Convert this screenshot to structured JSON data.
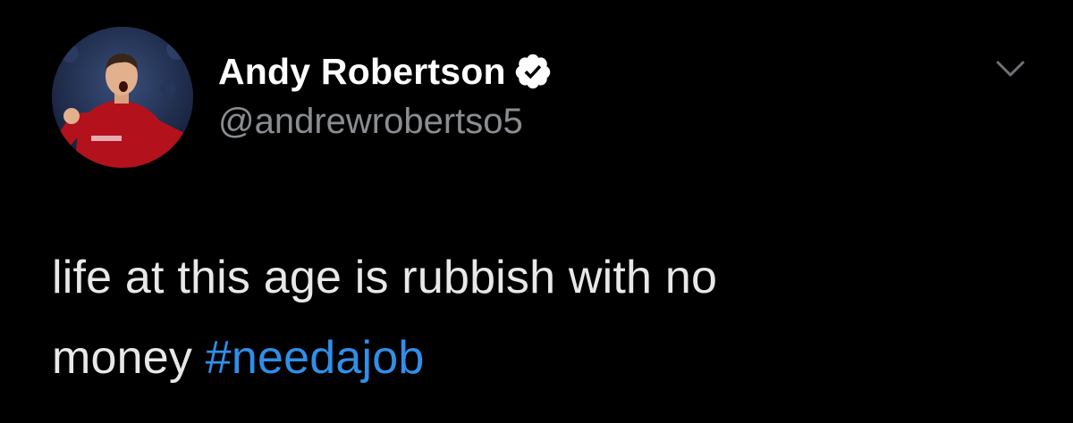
{
  "author": {
    "display_name": "Andy Robertson",
    "handle": "@andrewrobertso5",
    "verified": true,
    "avatar_icon": "profile-photo"
  },
  "tweet": {
    "line1": "life at this age is rubbish with no",
    "line2_text": "money",
    "hashtag": "#needajob"
  },
  "icons": {
    "verified": "verified-badge-icon",
    "menu": "chevron-down-icon"
  },
  "colors": {
    "background": "#000000",
    "name": "#ffffff",
    "handle": "#8a8d91",
    "text": "#e8e8e8",
    "hashtag": "#2f8fea"
  }
}
